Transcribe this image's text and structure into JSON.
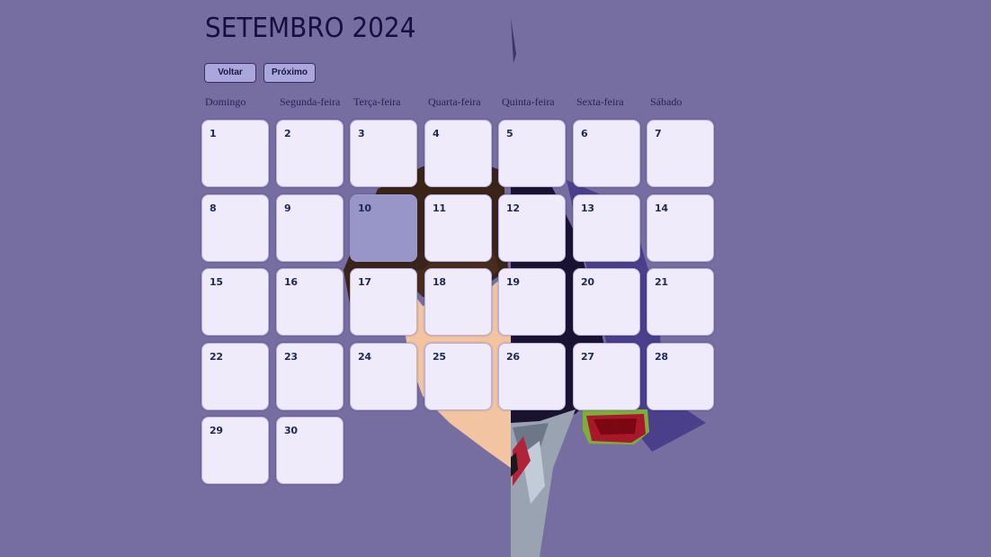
{
  "calendar": {
    "title": "SETEMBRO 2024",
    "back_label": "Voltar",
    "next_label": "Próximo",
    "weekdays": [
      "Domingo",
      "Segunda-feira",
      "Terça-feira",
      "Quarta-feira",
      "Quinta-feira",
      "Sexta-feira",
      "Sábado"
    ],
    "days": [
      "1",
      "2",
      "3",
      "4",
      "5",
      "6",
      "7",
      "8",
      "9",
      "10",
      "11",
      "12",
      "13",
      "14",
      "15",
      "16",
      "17",
      "18",
      "19",
      "20",
      "21",
      "22",
      "23",
      "24",
      "25",
      "26",
      "27",
      "28",
      "29",
      "30"
    ],
    "highlighted_day": "10"
  },
  "colors": {
    "page_background": "#766ea0",
    "day_cell": "#f0ebfb",
    "highlighted_cell": "#9895c9",
    "button": "#aba7dd",
    "title_text": "#160f3c"
  }
}
